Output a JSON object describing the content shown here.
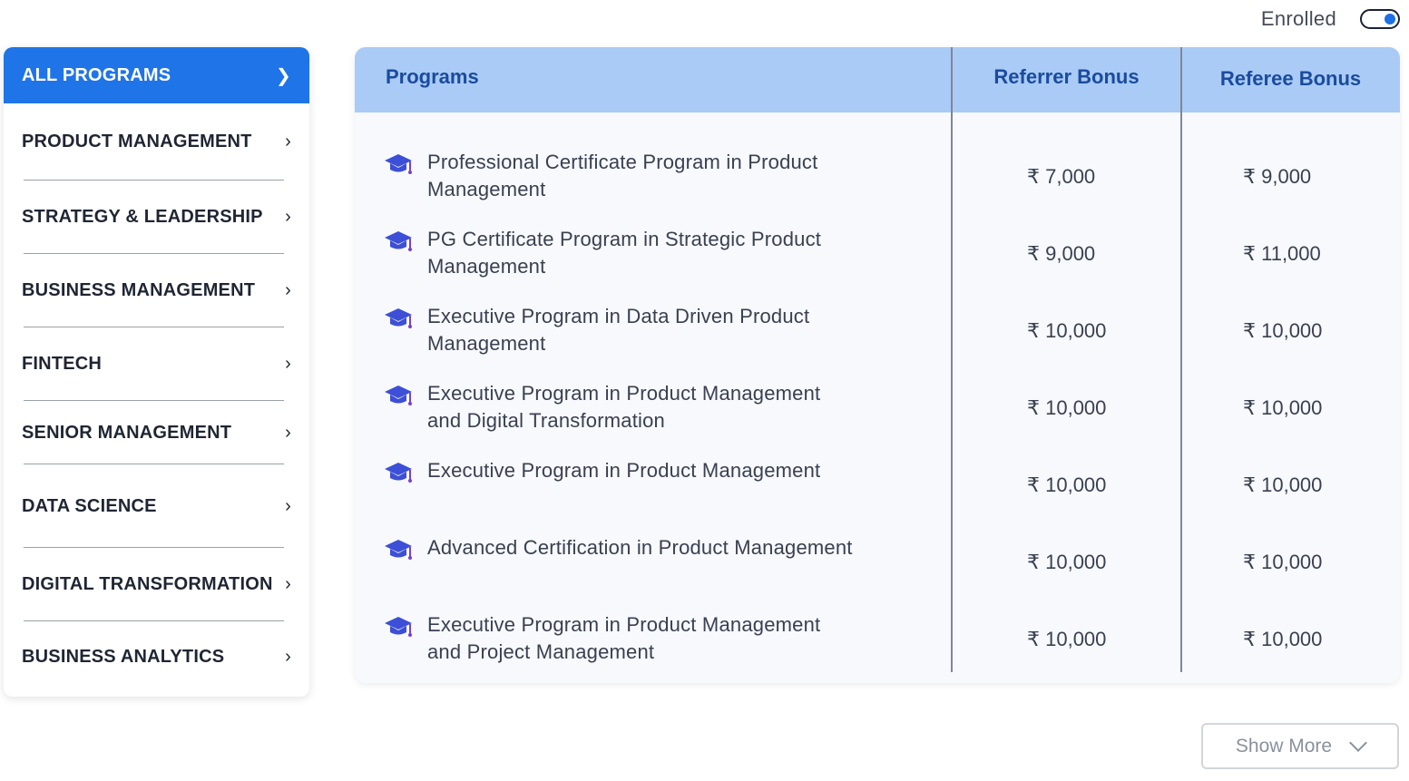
{
  "enrolled": {
    "label": "Enrolled",
    "toggle_on": true
  },
  "sidebar": {
    "items": [
      {
        "label": "ALL PROGRAMS",
        "active": true
      },
      {
        "label": "PRODUCT MANAGEMENT"
      },
      {
        "label": "STRATEGY & LEADERSHIP"
      },
      {
        "label": "BUSINESS MANAGEMENT"
      },
      {
        "label": "FINTECH"
      },
      {
        "label": "SENIOR MANAGEMENT"
      },
      {
        "label": "DATA SCIENCE"
      },
      {
        "label": "DIGITAL TRANSFORMATION"
      },
      {
        "label": "BUSINESS ANALYTICS"
      }
    ]
  },
  "table": {
    "headers": {
      "programs": "Programs",
      "referrer": "Referrer Bonus",
      "referee": "Referee Bonus"
    },
    "rows": [
      {
        "program": "Professional Certificate Program in Product Management",
        "referrer": "₹ 7,000",
        "referee": "₹ 9,000"
      },
      {
        "program": "PG Certificate Program in Strategic Product Management",
        "referrer": "₹ 9,000",
        "referee": "₹ 11,000"
      },
      {
        "program": "Executive Program in Data Driven Product Management",
        "referrer": "₹ 10,000",
        "referee": "₹ 10,000"
      },
      {
        "program": "Executive Program in Product Management and Digital Transformation",
        "referrer": "₹ 10,000",
        "referee": "₹ 10,000"
      },
      {
        "program": "Executive Program in Product Management",
        "referrer": "₹ 10,000",
        "referee": "₹ 10,000"
      },
      {
        "program": "Advanced Certification in Product Management",
        "referrer": "₹ 10,000",
        "referee": "₹ 10,000"
      },
      {
        "program": "Executive Program in Product Management and Project Management",
        "referrer": "₹ 10,000",
        "referee": "₹ 10,000"
      }
    ]
  },
  "show_more": {
    "label": "Show More"
  },
  "colors": {
    "accent": "#1f74e8",
    "header_bg": "#a9cbf5",
    "header_text": "#1b4b9e",
    "cap_icon": "#3d4fd6"
  }
}
